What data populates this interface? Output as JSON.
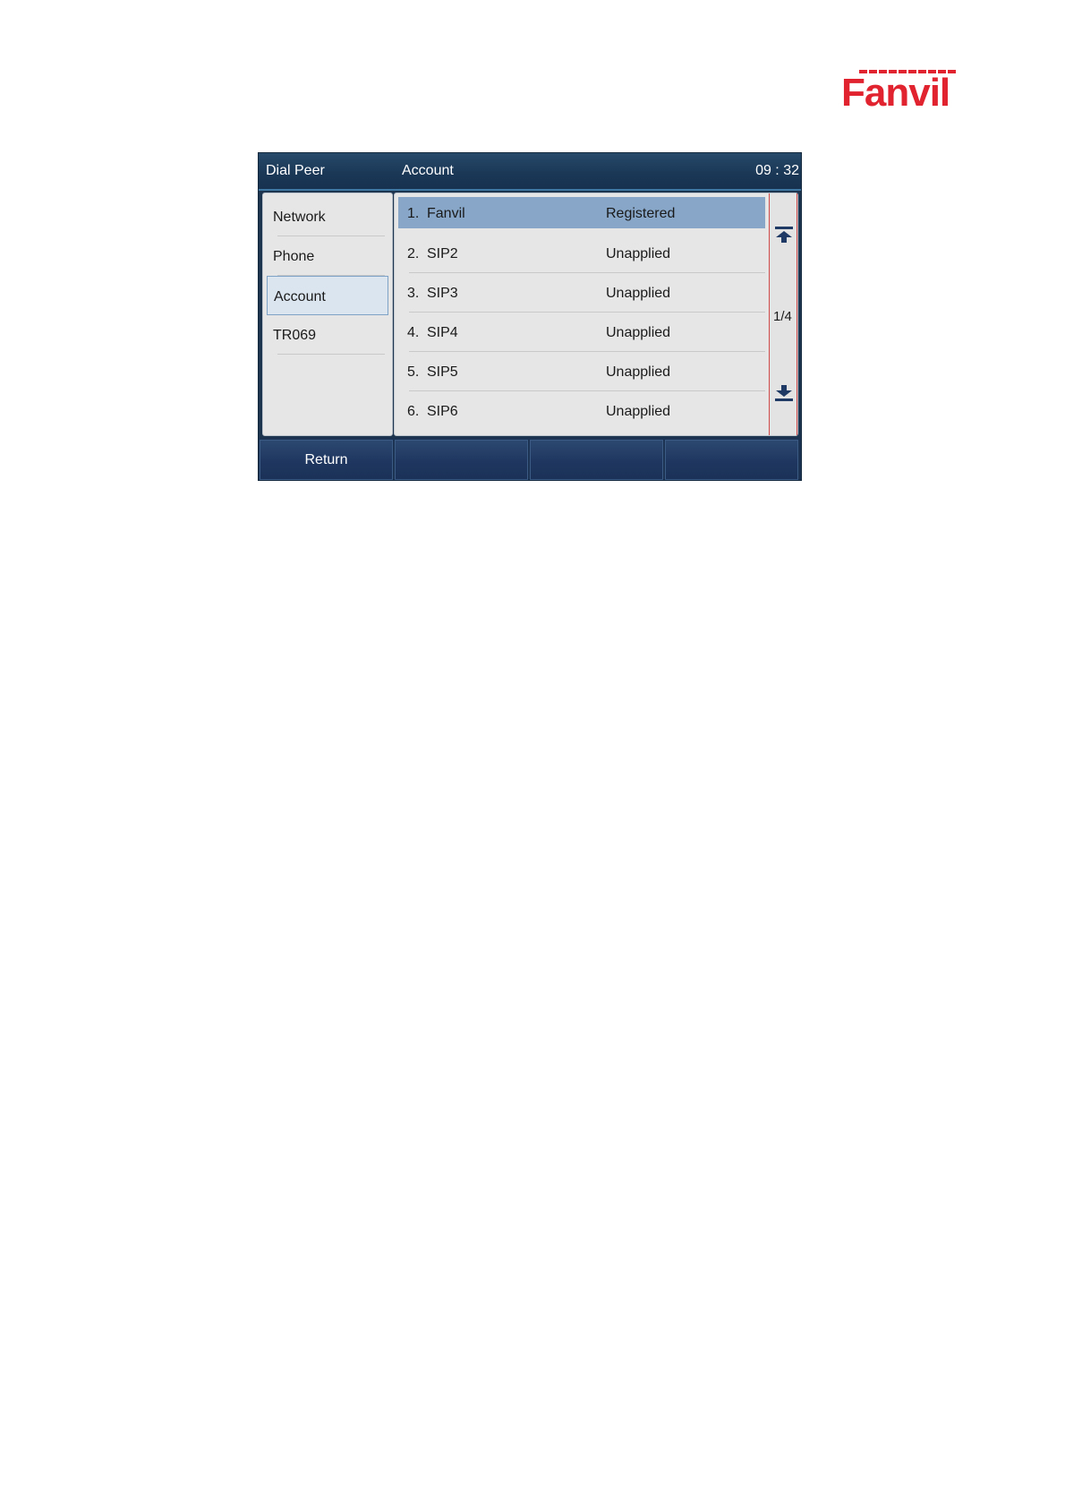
{
  "brand": {
    "logo_text": "Fanvil",
    "color": "#e0232f"
  },
  "header": {
    "left": "Dial Peer",
    "title": "Account",
    "time": "09 : 32"
  },
  "menu": {
    "items": [
      {
        "label": "Network"
      },
      {
        "label": "Phone"
      },
      {
        "label": "Account",
        "active": true
      },
      {
        "label": "TR069"
      }
    ]
  },
  "accounts": {
    "rows": [
      {
        "num": "1.",
        "name": "Fanvil",
        "status": "Registered",
        "selected": true
      },
      {
        "num": "2.",
        "name": "SIP2",
        "status": "Unapplied"
      },
      {
        "num": "3.",
        "name": "SIP3",
        "status": "Unapplied"
      },
      {
        "num": "4.",
        "name": "SIP4",
        "status": "Unapplied"
      },
      {
        "num": "5.",
        "name": "SIP5",
        "status": "Unapplied"
      },
      {
        "num": "6.",
        "name": "SIP6",
        "status": "Unapplied"
      }
    ],
    "page_indicator": "1/4",
    "scroll_icons": {
      "top": "scroll-to-top-icon",
      "bottom": "scroll-to-bottom-icon"
    }
  },
  "softkeys": [
    "Return",
    "",
    "",
    ""
  ],
  "colors": {
    "selection": "#87a6c8",
    "header_bg": "#1b3857",
    "scrollbar_border": "#d04a4a"
  }
}
